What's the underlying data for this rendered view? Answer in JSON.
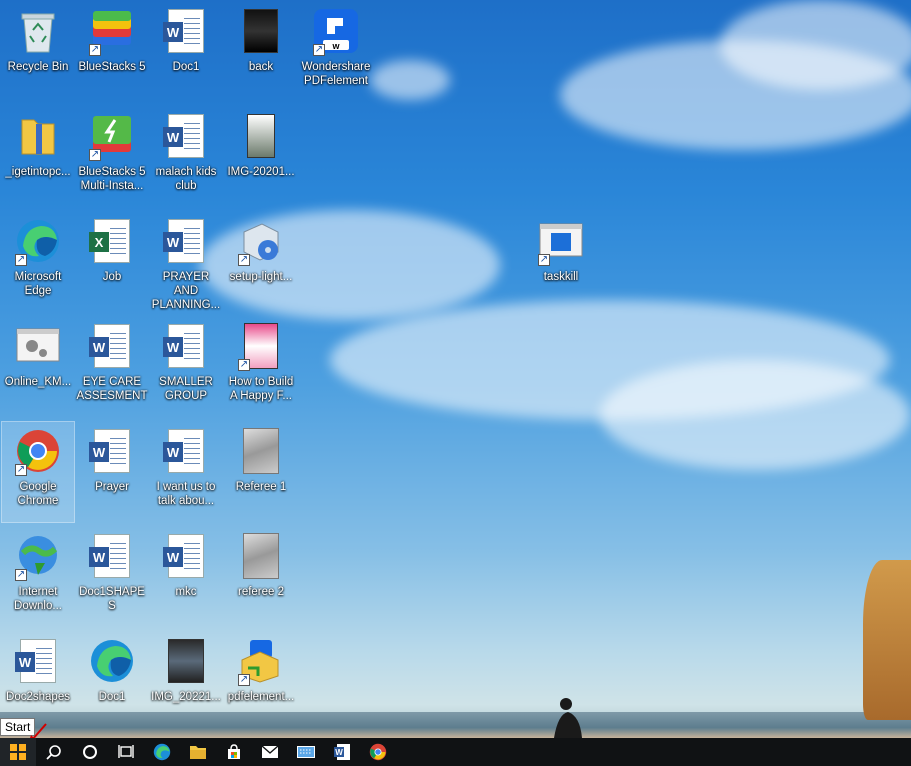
{
  "desktop": {
    "icons": [
      {
        "label": "Recycle Bin"
      },
      {
        "label": "BlueStacks 5"
      },
      {
        "label": "Doc1"
      },
      {
        "label": "back"
      },
      {
        "label": "Wondershare PDFelement"
      },
      {
        "label": "_igetintopc..."
      },
      {
        "label": "BlueStacks 5 Multi-Insta..."
      },
      {
        "label": "malach kids club"
      },
      {
        "label": "IMG-20201..."
      },
      {
        "label": "Microsoft Edge"
      },
      {
        "label": "Job"
      },
      {
        "label": "PRAYER AND PLANNING..."
      },
      {
        "label": "setup-light..."
      },
      {
        "label": "taskkill"
      },
      {
        "label": "Online_KM..."
      },
      {
        "label": "EYE CARE ASSESMENT"
      },
      {
        "label": "SMALLER GROUP"
      },
      {
        "label": "How to Build A Happy F..."
      },
      {
        "label": "Google Chrome"
      },
      {
        "label": "Prayer"
      },
      {
        "label": "I want us to talk abou..."
      },
      {
        "label": "Referee 1"
      },
      {
        "label": "Internet Downlo..."
      },
      {
        "label": "Doc1SHAPES"
      },
      {
        "label": "mkc"
      },
      {
        "label": "referee 2"
      },
      {
        "label": "Doc2shapes"
      },
      {
        "label": "Doc1"
      },
      {
        "label": "IMG_20221..."
      },
      {
        "label": "pdfelement..."
      }
    ]
  },
  "tooltip": {
    "text": "Start"
  },
  "taskbar": {
    "items": [
      {
        "name": "start-windows-icon"
      },
      {
        "name": "search-icon"
      },
      {
        "name": "cortana-icon"
      },
      {
        "name": "task-view-icon"
      },
      {
        "name": "edge-icon"
      },
      {
        "name": "file-explorer-icon"
      },
      {
        "name": "store-icon"
      },
      {
        "name": "mail-icon"
      },
      {
        "name": "keyboard-icon"
      },
      {
        "name": "word-icon"
      },
      {
        "name": "chrome-icon"
      }
    ]
  }
}
